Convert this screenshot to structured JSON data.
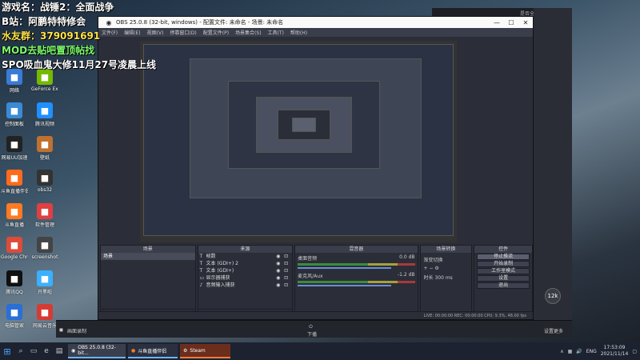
{
  "overlay": {
    "line1": "游戏名：战锤2：全面战争",
    "line2": "B站：阿鹏特特修会",
    "line3": "水友群：379091691",
    "line4": "MOD去贴吧置顶帖找",
    "line5": "SPO吸血鬼大修11月27号凌晨上线"
  },
  "desktop_icons": [
    {
      "label": "网络",
      "icon": "network-icon",
      "color": "#3a7bd5"
    },
    {
      "label": "GeForce Experience",
      "icon": "nvidia-icon",
      "color": "#76b900"
    },
    {
      "label": "控制面板",
      "icon": "control-panel-icon",
      "color": "#3a8ad5"
    },
    {
      "label": "腾讯视频",
      "icon": "video-icon",
      "color": "#1e90ff"
    },
    {
      "label": "网易UU加速",
      "icon": "uu-icon",
      "color": "#222"
    },
    {
      "label": "壁纸",
      "icon": "wallpaper-icon",
      "color": "#c07030"
    },
    {
      "label": "斗鱼直播伴侣",
      "icon": "douyu-icon",
      "color": "#ff6b1a"
    },
    {
      "label": "obs32",
      "icon": "obs-icon",
      "color": "#333"
    },
    {
      "label": "斗鱼直播",
      "icon": "douyu-live-icon",
      "color": "#ff7a20"
    },
    {
      "label": "软件管理",
      "icon": "app-manager-icon",
      "color": "#e04040"
    },
    {
      "label": "Google Chrome",
      "icon": "chrome-icon",
      "color": "#dd4b39"
    },
    {
      "label": "screenshot",
      "icon": "screenshot-icon",
      "color": "#444"
    },
    {
      "label": "腾讯QQ",
      "icon": "qq-icon",
      "color": "#111"
    },
    {
      "label": "开黑啦",
      "icon": "kaiheila-icon",
      "color": "#3ab0ff"
    },
    {
      "label": "电脑管家",
      "icon": "pc-manager-icon",
      "color": "#2a6fd5"
    },
    {
      "label": "网易云音乐",
      "icon": "netease-music-icon",
      "color": "#d43c33"
    }
  ],
  "obs": {
    "title": "OBS 25.0.8 (32-bit, windows) - 配置文件: 未命名 - 场景: 未命名",
    "menu": [
      "文件(F)",
      "编辑(E)",
      "视图(V)",
      "停靠窗口(D)",
      "配置文件(P)",
      "场景集合(S)",
      "工具(T)",
      "帮助(H)"
    ],
    "docks": {
      "scenes": {
        "title": "场景",
        "items": [
          "场景"
        ]
      },
      "sources": {
        "title": "来源",
        "items": [
          {
            "name": "帧数",
            "icon": "text-icon"
          },
          {
            "name": "文本 (GDI+) 2",
            "icon": "text-icon"
          },
          {
            "name": "文本 (GDI+)",
            "icon": "text-icon"
          },
          {
            "name": "显示器捕获",
            "icon": "monitor-icon"
          },
          {
            "name": "音频输入捕获",
            "icon": "mic-icon"
          }
        ]
      },
      "mixer": {
        "title": "混音器",
        "channels": [
          {
            "name": "桌面音频",
            "db": "0.0 dB"
          },
          {
            "name": "麦克风/Aux",
            "db": "-1.2 dB"
          }
        ]
      },
      "transitions": {
        "title": "场景转换",
        "type": "渐变切换",
        "duration_label": "时长",
        "duration": "300 ms"
      },
      "controls": {
        "title": "控件",
        "buttons": [
          "停止推流",
          "开始录制",
          "工作室模式",
          "设置",
          "退出"
        ]
      }
    },
    "status": "LIVE: 00:00:00   REC: 00:00:00   CPU: 9.3%, 48.00 fps"
  },
  "outer": {
    "top_right": "是否全屏显示",
    "bottom_left": "画面录制",
    "bottom_center": "下播",
    "bottom_right": "设置更多",
    "side_button": "12k"
  },
  "taskbar": {
    "apps": [
      {
        "label": "OBS 25.0.8 (32-bit...",
        "icon": "obs-icon"
      },
      {
        "label": "斗鱼直播伴侣",
        "icon": "douyu-icon"
      },
      {
        "label": "Steam",
        "icon": "steam-icon"
      }
    ],
    "lang": "ENG",
    "time": "17:53:09",
    "date": "2021/11/14"
  }
}
